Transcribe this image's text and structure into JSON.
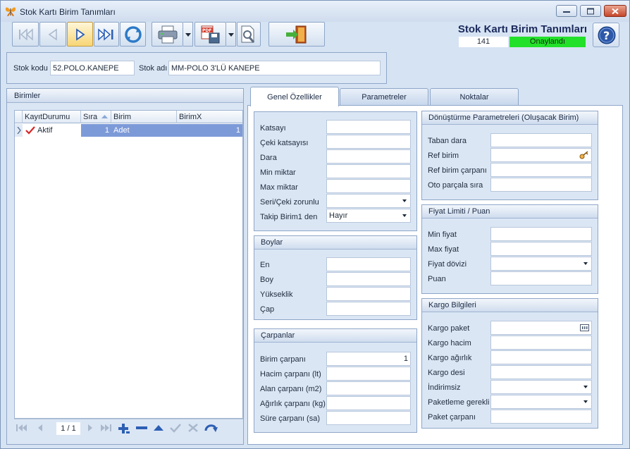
{
  "window": {
    "title": "Stok Kartı Birim Tanımları"
  },
  "header": {
    "title": "Stok Kartı Birim Tanımları",
    "count": "141",
    "status": "Onaylandı",
    "status_color": "#23e02b"
  },
  "stok": {
    "code_label": "Stok kodu",
    "code_value": "52.POLO.KANEPE",
    "name_label": "Stok adı",
    "name_value": "MM-POLO 3'LÜ KANEPE"
  },
  "birimler": {
    "title": "Birimler",
    "columns": [
      "KayıtDurumu",
      "Sıra",
      "Birim",
      "BirimX"
    ],
    "rows": [
      {
        "durum": "Aktif",
        "sira": "1",
        "birim": "Adet",
        "birimx": "1"
      }
    ],
    "pager": "1 / 1"
  },
  "tabs": [
    "Genel Özellikler",
    "Parametreler",
    "Noktalar"
  ],
  "genel": {
    "fields": [
      {
        "label": "Katsayı",
        "value": ""
      },
      {
        "label": "Çeki katsayısı",
        "value": ""
      },
      {
        "label": "Dara",
        "value": ""
      },
      {
        "label": "Min miktar",
        "value": ""
      },
      {
        "label": "Max miktar",
        "value": ""
      },
      {
        "label": "Seri/Çeki zorunlu",
        "value": ""
      },
      {
        "label": "Takip Birim1 den",
        "value": "Hayır"
      }
    ]
  },
  "boylar": {
    "title": "Boylar",
    "fields": [
      {
        "label": "En",
        "value": ""
      },
      {
        "label": "Boy",
        "value": ""
      },
      {
        "label": "Yükseklik",
        "value": ""
      },
      {
        "label": "Çap",
        "value": ""
      }
    ]
  },
  "carpanlar": {
    "title": "Çarpanlar",
    "fields": [
      {
        "label": "Birim çarpanı",
        "value": "1"
      },
      {
        "label": "Hacim çarpanı (lt)",
        "value": ""
      },
      {
        "label": "Alan çarpanı (m2)",
        "value": ""
      },
      {
        "label": "Ağırlık çarpanı (kg)",
        "value": ""
      },
      {
        "label": "Süre çarpanı (sa)",
        "value": ""
      }
    ]
  },
  "donusturme": {
    "title": "Dönüştürme Parametreleri (Oluşacak Birim)",
    "fields": [
      {
        "label": "Taban dara",
        "value": ""
      },
      {
        "label": "Ref birim",
        "value": ""
      },
      {
        "label": "Ref birim çarpanı",
        "value": ""
      },
      {
        "label": "Oto parçala sıra",
        "value": ""
      }
    ]
  },
  "fiyat": {
    "title": "Fiyat Limiti / Puan",
    "fields": [
      {
        "label": "Min fiyat",
        "value": ""
      },
      {
        "label": "Max fiyat",
        "value": ""
      },
      {
        "label": "Fiyat dövizi",
        "value": ""
      },
      {
        "label": "Puan",
        "value": ""
      }
    ]
  },
  "kargo": {
    "title": "Kargo Bilgileri",
    "fields": [
      {
        "label": "Kargo paket",
        "value": ""
      },
      {
        "label": "Kargo hacim",
        "value": ""
      },
      {
        "label": "Kargo ağırlık",
        "value": ""
      },
      {
        "label": "Kargo desi",
        "value": ""
      },
      {
        "label": "İndirimsiz",
        "value": ""
      },
      {
        "label": "Paketleme gerekli",
        "value": ""
      },
      {
        "label": "Paket çarpanı",
        "value": ""
      }
    ]
  }
}
